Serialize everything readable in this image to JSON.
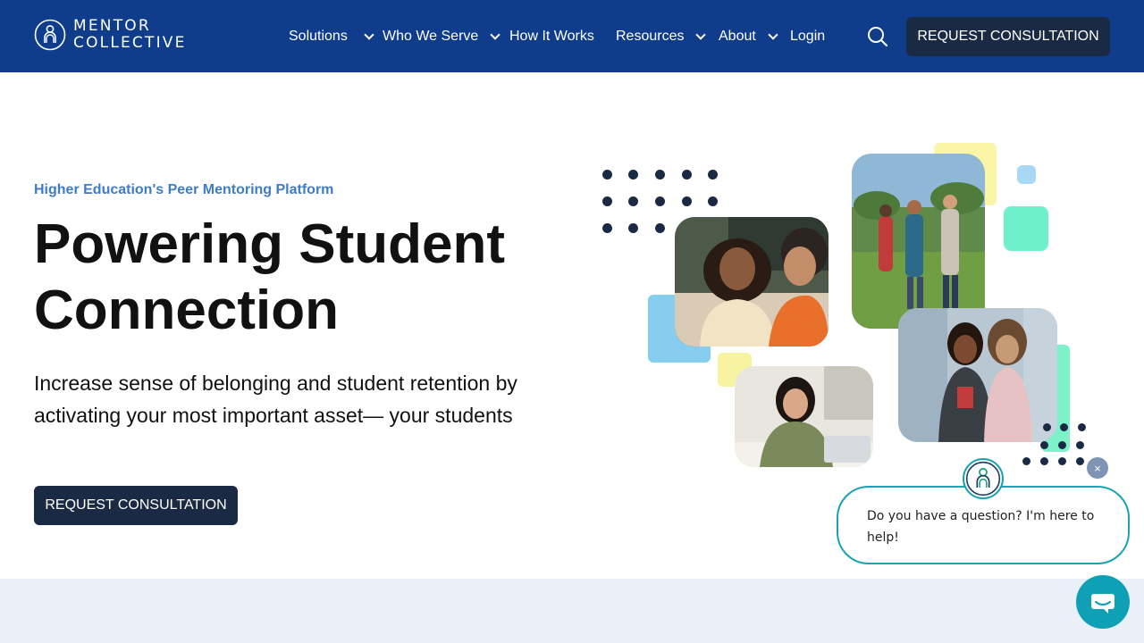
{
  "brand": {
    "logo_line1": "MENTOR",
    "logo_line2": "COLLECTIVE",
    "logo_icon": "mentor-collective-logo-icon",
    "primary_color": "#0f3d8c",
    "button_color": "#1b2a44",
    "eyebrow_color": "#3d7cc9",
    "chat_color": "#1aa3b5"
  },
  "nav": {
    "items": [
      {
        "label": "Solutions",
        "has_dropdown": true
      },
      {
        "label": "Who We Serve",
        "has_dropdown": true
      },
      {
        "label": "How It Works",
        "has_dropdown": false
      },
      {
        "label": "Resources",
        "has_dropdown": true
      },
      {
        "label": "About",
        "has_dropdown": true
      },
      {
        "label": "Login",
        "has_dropdown": false
      }
    ],
    "search_icon": "search-icon",
    "cta_label": "REQUEST CONSULTATION"
  },
  "hero": {
    "eyebrow": "Higher Education's Peer Mentoring Platform",
    "headline_line1": "Powering Student",
    "headline_line2": "Connection",
    "subhead": "Increase sense of belonging and student retention by activating your most important asset— your students",
    "cta_label": "REQUEST CONSULTATION"
  },
  "chat": {
    "message": "Do you have a question? I'm here to help!",
    "close_symbol": "×",
    "launcher_icon": "chat-bubble-icon"
  }
}
